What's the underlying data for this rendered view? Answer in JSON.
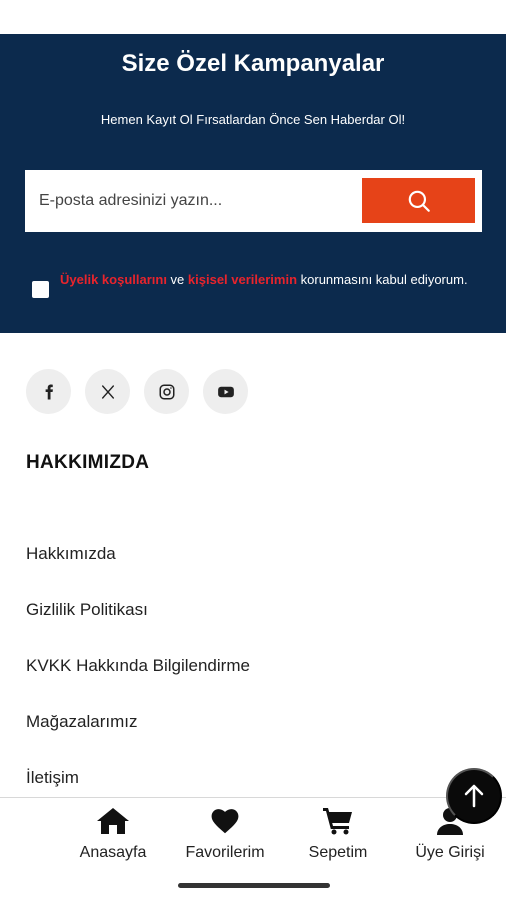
{
  "newsletter": {
    "title": "Size Özel Kampanyalar",
    "subtitle": "Hemen Kayıt Ol Fırsatlardan Önce Sen Haberdar Ol!",
    "email_placeholder": "E-posta adresinizi yazın...",
    "search_icon": "search-icon",
    "consent": {
      "link1": "Üyelik koşullarını",
      "conj": " ve ",
      "link2": "kişisel verilerimin",
      "rest": " korunmasını kabul ediyorum."
    }
  },
  "social": [
    "facebook-icon",
    "x-icon",
    "instagram-icon",
    "youtube-icon"
  ],
  "about": {
    "title": "HAKKIMIZDA",
    "links": [
      "Hakkımızda",
      "Gizlilik Politikası",
      "KVKK Hakkında Bilgilendirme",
      "Mağazalarımız",
      "İletişim"
    ]
  },
  "bottom_nav": {
    "items": [
      {
        "label": "Anasayfa",
        "icon": "home-icon"
      },
      {
        "label": "Favorilerim",
        "icon": "heart-icon"
      },
      {
        "label": "Sepetim",
        "icon": "cart-icon"
      },
      {
        "label": "Üye Girişi",
        "icon": "user-icon"
      }
    ]
  },
  "scroll_top_icon": "arrow-up-icon",
  "colors": {
    "newsletter_bg": "#0c2a4d",
    "accent": "#e64318",
    "consent_link": "#e8242c"
  }
}
